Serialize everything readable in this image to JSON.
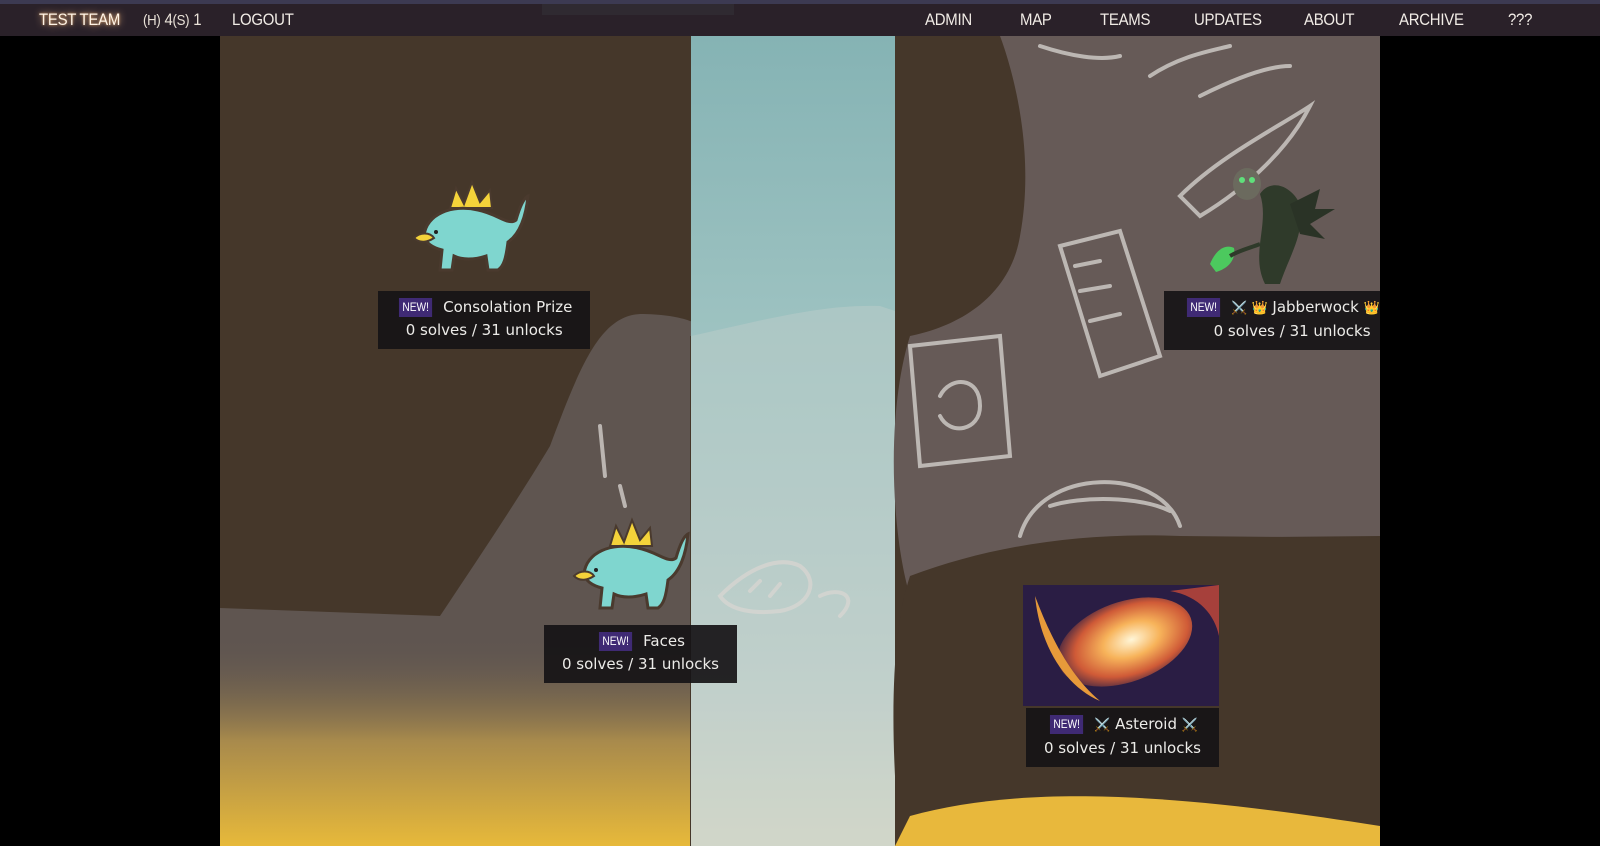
{
  "navbar": {
    "team_name": "TEST TEAM",
    "score_h_label": "(H)",
    "score_h_value": "4",
    "score_s_label": "(S)",
    "score_s_value": "1",
    "logout": "LOGOUT",
    "links": [
      "ADMIN",
      "MAP",
      "TEAMS",
      "UPDATES",
      "ABOUT",
      "ARCHIVE",
      "???"
    ]
  },
  "puzzles": [
    {
      "new_badge": "NEW!",
      "title": "Consolation Prize",
      "stats": "0 solves / 31 unlocks",
      "icon": "stegosaurus-icon"
    },
    {
      "new_badge": "NEW!",
      "prefix": "⚔️ 👑",
      "title": "Jabberwock",
      "suffix": "👑 ⚔️",
      "stats": "0 solves / 31 unlocks",
      "icon": "jabberwock-icon"
    },
    {
      "new_badge": "NEW!",
      "title": "Faces",
      "stats": "0 solves / 31 unlocks",
      "icon": "stegosaurus-icon"
    },
    {
      "new_badge": "NEW!",
      "prefix": "⚔️",
      "title": "Asteroid",
      "suffix": "⚔️",
      "stats": "0 solves / 31 unlocks",
      "icon": "asteroid-image"
    }
  ],
  "colors": {
    "navbar_bg": "#2a2129",
    "badge_bg": "#3f2a74",
    "map_dark": "#45372a",
    "map_gray": "#5f5550",
    "waterfall": "#9ac3c3"
  }
}
